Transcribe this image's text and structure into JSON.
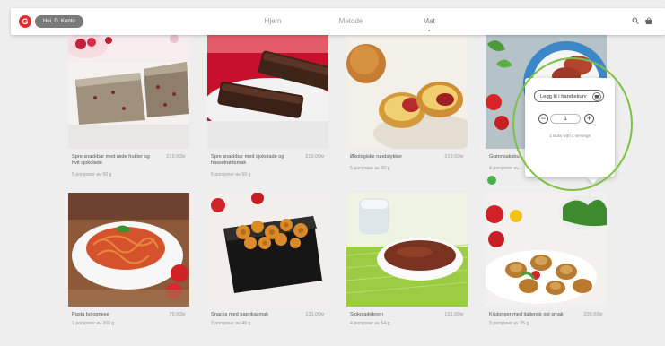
{
  "nav": {
    "logo": "G",
    "user": "Hei, D. Konto",
    "links": [
      "Hjem",
      "Metode",
      "Mat"
    ],
    "active": "Mat"
  },
  "icons": {
    "search": "search-icon",
    "basket": "basket-icon",
    "plus": "+",
    "minus": "−"
  },
  "products": [
    {
      "name": "Spre snackbar med røde frukter og hvit sjokolade",
      "price": "219,00kr",
      "portions": "5 porsjoner av 50 g"
    },
    {
      "name": "Spre snackbar med sjokolade og hasselnøttsmak",
      "price": "219,00kr",
      "portions": "5 porsjoner av 50 g"
    },
    {
      "name": "Økologiske rundstykker",
      "price": "219,00kr",
      "portions": "5 porsjoner av 60 g"
    },
    {
      "name": "Grønnsaksbu...",
      "price": "",
      "portions": "4 porsjoner av..."
    },
    {
      "name": "Pasta bolognese",
      "price": "79,00kr",
      "portions": "1 porsjoner av 200 g"
    },
    {
      "name": "Snacks med paprikasmak",
      "price": "131,00kr",
      "portions": "3 porsjoner av 40 g"
    },
    {
      "name": "Sjokoladekrem",
      "price": "131,00kr",
      "portions": "4 porsjoner av 54 g"
    },
    {
      "name": "Krutonger med italiensk ost smak",
      "price": "109,00kr",
      "portions": "3 porsjoner av 25 g"
    }
  ],
  "popup": {
    "add_label": "Legg til i handlekurv",
    "quantity": "1",
    "note": "1 Boks with 4 servings"
  },
  "colors": {
    "brand": "#e22b2b",
    "highlight": "#7cc242",
    "badge": "#48b14a"
  }
}
